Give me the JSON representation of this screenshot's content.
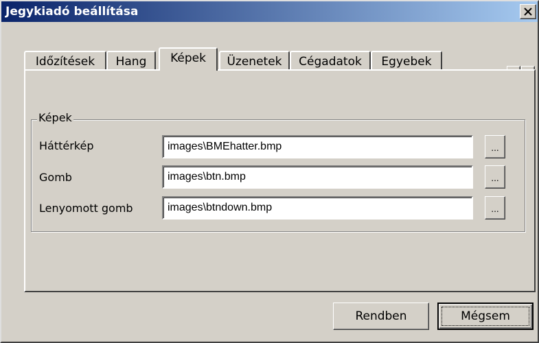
{
  "window": {
    "title": "Jegykiadó beállítása",
    "close_glyph": "✕"
  },
  "tabs": [
    {
      "label": "Időzítések",
      "selected": false
    },
    {
      "label": "Hang",
      "selected": false
    },
    {
      "label": "Képek",
      "selected": true
    },
    {
      "label": "Üzenetek",
      "selected": false
    },
    {
      "label": "Cégadatok",
      "selected": false
    },
    {
      "label": "Egyebek",
      "selected": false
    }
  ],
  "tab_scroll": {
    "left_icon": "triangle-left-icon",
    "right_icon": "triangle-right-icon"
  },
  "group": {
    "title": "Képek",
    "fields": [
      {
        "label": "Háttérkép",
        "value": "images\\BMEhatter.bmp",
        "browse_label": "..."
      },
      {
        "label": "Gomb",
        "value": "images\\btn.bmp",
        "browse_label": "..."
      },
      {
        "label": "Lenyomott gomb",
        "value": "images\\btndown.bmp",
        "browse_label": "..."
      }
    ]
  },
  "buttons": {
    "ok_label": "Rendben",
    "cancel_label": "Mégsem"
  },
  "colors": {
    "face": "#d4d0c8",
    "title_start": "#0a246a",
    "title_end": "#a6caf0"
  }
}
